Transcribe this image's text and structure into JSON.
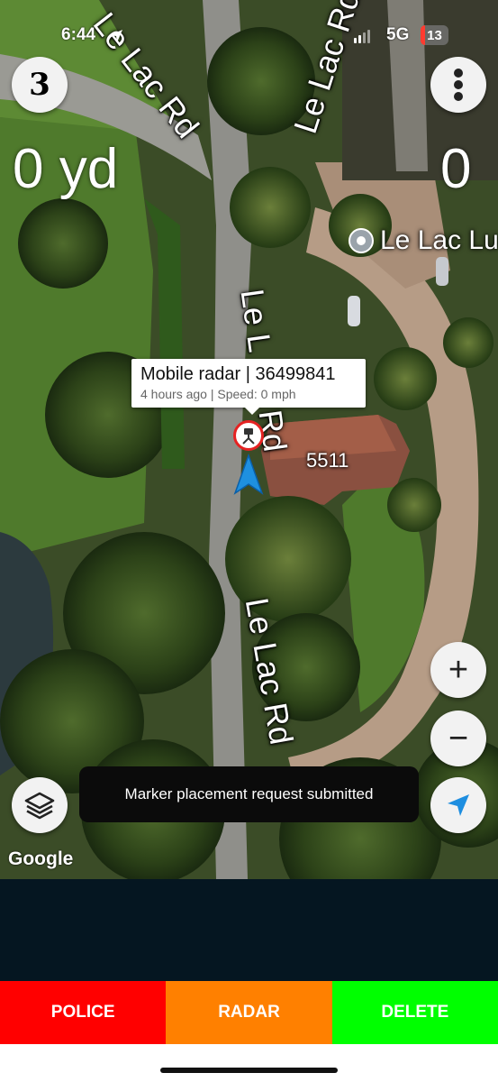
{
  "status_bar": {
    "time": "6:44",
    "network": "5G",
    "battery": "13"
  },
  "map": {
    "road_labels": [
      "Le Lac Rd",
      "Le Lac Rd",
      "Le L",
      "Rd",
      "Le Lac Rd"
    ],
    "place_label": "Le Lac Lu",
    "address_label": "5511",
    "google_logo": "Google"
  },
  "hud": {
    "speed_value": "3",
    "distance_left": "0 yd",
    "distance_right": "0"
  },
  "popup": {
    "title": "Mobile radar | 36499841",
    "subtitle": "4 hours ago | Speed: 0 mph"
  },
  "toast": {
    "message": "Marker placement request submitted"
  },
  "controls": {
    "zoom_in": "+",
    "zoom_out": "−"
  },
  "actions": {
    "police": "POLICE",
    "radar": "RADAR",
    "delete": "DELETE"
  },
  "colors": {
    "police": "#ff0000",
    "radar": "#ff8000",
    "delete": "#00ff00",
    "dark_panel": "#051621",
    "location_arrow": "#1e90e0"
  },
  "icons": {
    "menu": "more-vertical-icon",
    "layers": "layers-icon",
    "recenter": "navigation-arrow-icon",
    "radar_marker": "speed-camera-icon",
    "current_location": "location-arrow-icon",
    "place_pin": "map-pin-icon"
  }
}
